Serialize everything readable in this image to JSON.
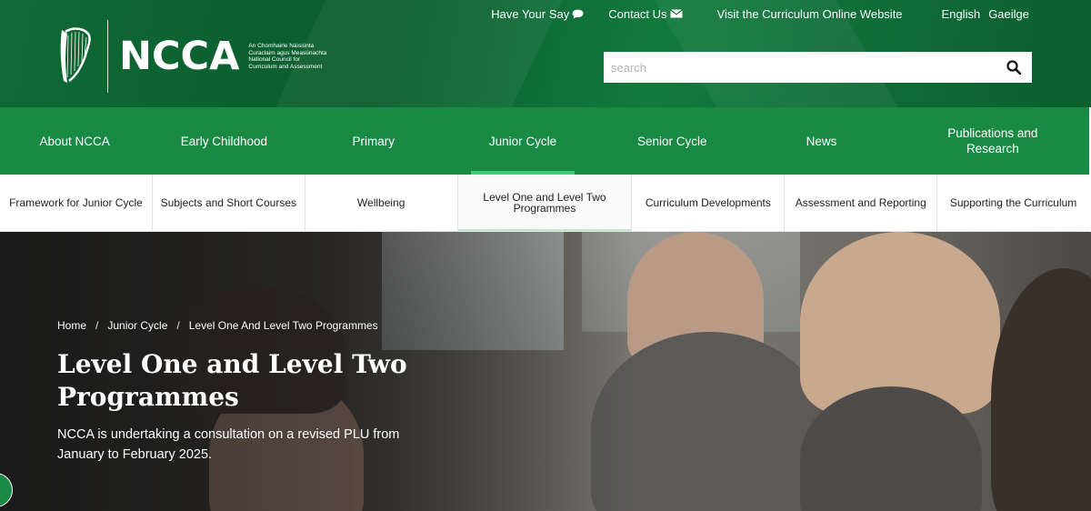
{
  "header": {
    "logo_text": "NCCA",
    "logo_sub": [
      "An Chomhairle Náisiúnta",
      "Curaclaim agus Measúnachta",
      "National Council for",
      "Curriculum and Assessment"
    ],
    "top_links": {
      "have_your_say": "Have Your Say",
      "contact_us": "Contact Us",
      "curriculum_online": "Visit the Curriculum Online Website",
      "english": "English",
      "gaeilge": "Gaeilge"
    },
    "search": {
      "placeholder": "search",
      "value": ""
    }
  },
  "main_nav": {
    "items": [
      {
        "label": "About NCCA"
      },
      {
        "label": "Early Childhood"
      },
      {
        "label": "Primary"
      },
      {
        "label": "Junior Cycle",
        "active": true
      },
      {
        "label": "Senior Cycle"
      },
      {
        "label": "News"
      },
      {
        "label": "Publications and Research"
      }
    ]
  },
  "sub_nav": {
    "items": [
      {
        "label": "Framework for Junior Cycle"
      },
      {
        "label": "Subjects and Short Courses"
      },
      {
        "label": "Wellbeing"
      },
      {
        "label": "Level One and Level Two Programmes",
        "active": true
      },
      {
        "label": "Curriculum Developments"
      },
      {
        "label": "Assessment and Reporting"
      },
      {
        "label": "Supporting the Curriculum"
      }
    ]
  },
  "hero": {
    "breadcrumb": {
      "home": "Home",
      "separator": "/",
      "section": "Junior Cycle",
      "current": "Level One And Level Two Programmes"
    },
    "title": "Level One and Level Two Programmes",
    "description": "NCCA is undertaking a consultation on a revised PLU from January to February 2025."
  },
  "colors": {
    "header_green": "#0f6a35",
    "nav_green": "#198a44",
    "active_underline": "#3fd07a"
  }
}
